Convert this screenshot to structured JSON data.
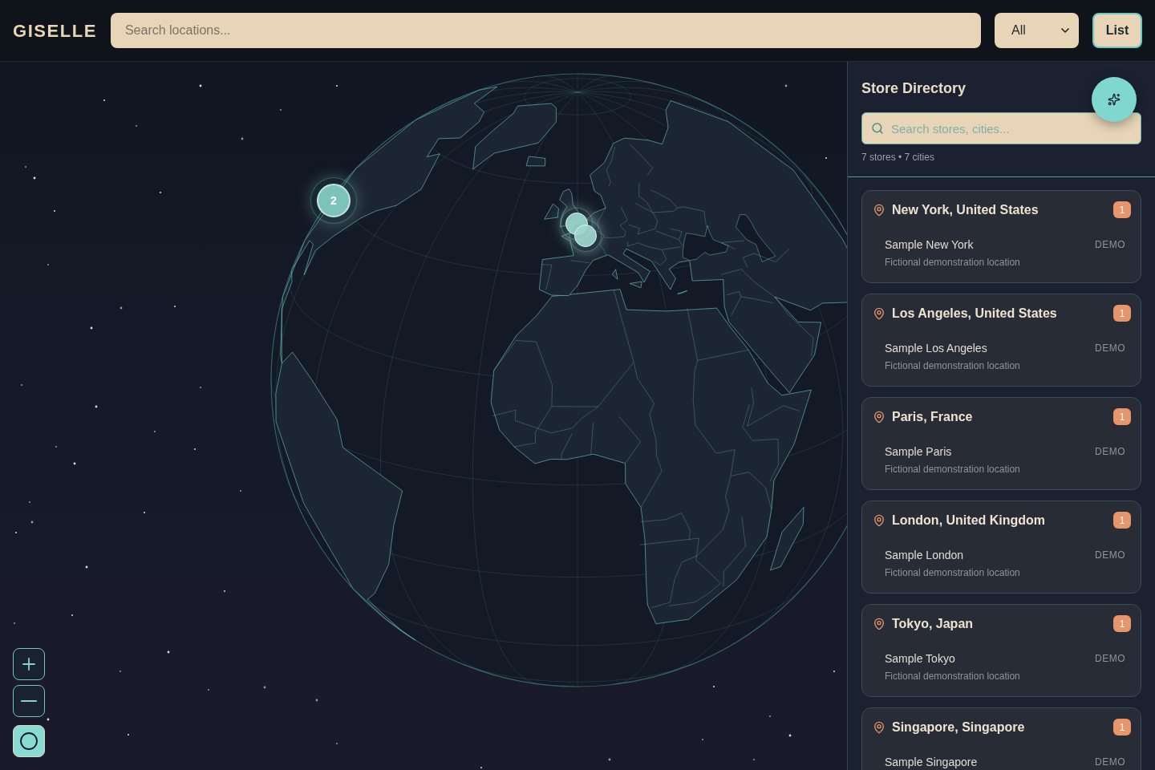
{
  "header": {
    "logo": "GISELLE",
    "search": {
      "placeholder": "Search locations..."
    },
    "filter": {
      "value": "All"
    },
    "view_button": {
      "label": "List",
      "selected": true
    }
  },
  "map": {
    "markers": [
      {
        "kind": "cluster",
        "count": "2"
      },
      {
        "kind": "point"
      },
      {
        "kind": "point"
      }
    ],
    "controls": [
      {
        "kind": "zoom_in",
        "selected": false
      },
      {
        "kind": "zoom_out",
        "selected": false
      },
      {
        "kind": "rotate",
        "selected": true
      }
    ]
  },
  "sidebar": {
    "title": "Store Directory",
    "search": {
      "placeholder": "Search stores, cities..."
    },
    "summary": "7 stores • 7 cities",
    "cities": [
      {
        "name": "New York, United States",
        "count": "1",
        "stores": [
          {
            "name": "Sample New York",
            "tag": "DEMO",
            "description": "Fictional demonstration location"
          }
        ]
      },
      {
        "name": "Los Angeles, United States",
        "count": "1",
        "stores": [
          {
            "name": "Sample Los Angeles",
            "tag": "DEMO",
            "description": "Fictional demonstration location"
          }
        ]
      },
      {
        "name": "Paris, France",
        "count": "1",
        "stores": [
          {
            "name": "Sample Paris",
            "tag": "DEMO",
            "description": "Fictional demonstration location"
          }
        ]
      },
      {
        "name": "London, United Kingdom",
        "count": "1",
        "stores": [
          {
            "name": "Sample London",
            "tag": "DEMO",
            "description": "Fictional demonstration location"
          }
        ]
      },
      {
        "name": "Tokyo, Japan",
        "count": "1",
        "stores": [
          {
            "name": "Sample Tokyo",
            "tag": "DEMO",
            "description": "Fictional demonstration location"
          }
        ]
      },
      {
        "name": "Singapore, Singapore",
        "count": "1",
        "stores": [
          {
            "name": "Sample Singapore",
            "tag": "DEMO"
          }
        ]
      }
    ]
  }
}
